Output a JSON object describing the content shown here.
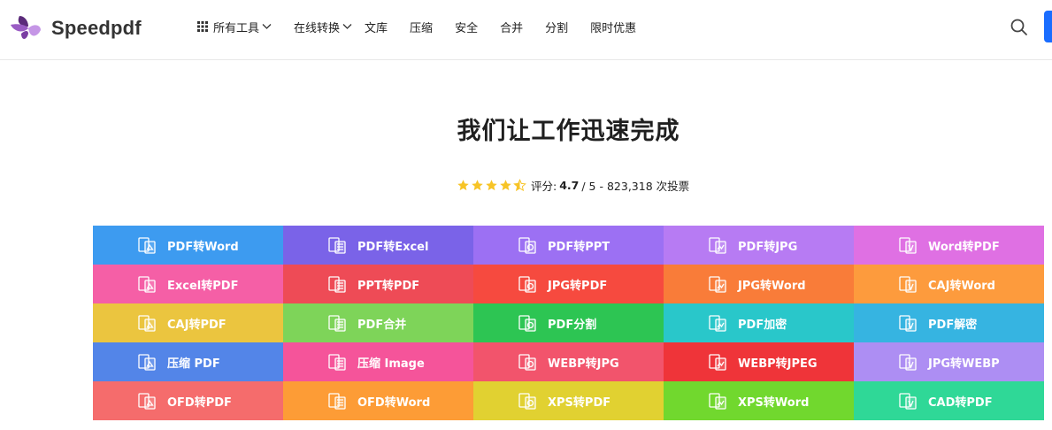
{
  "header": {
    "brand": "Speedpdf",
    "nav": [
      {
        "label": "所有工具",
        "icon": "grid-icon",
        "dropdown": true
      },
      {
        "label": "在线转换",
        "dropdown": true
      },
      {
        "label": "文库"
      },
      {
        "label": "压缩"
      },
      {
        "label": "安全"
      },
      {
        "label": "合并"
      },
      {
        "label": "分割"
      },
      {
        "label": "限时优惠"
      }
    ]
  },
  "hero": {
    "title": "我们让工作迅速完成",
    "rating": {
      "label": "评分:",
      "score": "4.7",
      "suffix": "/ 5 - 823,318 次投票",
      "stars_value": 4.5
    }
  },
  "tools": [
    {
      "label": "PDF转Word",
      "color": "#3d9bf0"
    },
    {
      "label": "PDF转Excel",
      "color": "#7a63e8"
    },
    {
      "label": "PDF转PPT",
      "color": "#9c70f3"
    },
    {
      "label": "PDF转JPG",
      "color": "#b77bf3"
    },
    {
      "label": "Word转PDF",
      "color": "#df70e3"
    },
    {
      "label": "Excel转PDF",
      "color": "#f55fa6"
    },
    {
      "label": "PPT转PDF",
      "color": "#ee4b56"
    },
    {
      "label": "JPG转PDF",
      "color": "#f64a3f"
    },
    {
      "label": "JPG转Word",
      "color": "#f97c39"
    },
    {
      "label": "CAJ转Word",
      "color": "#fd9b3d"
    },
    {
      "label": "CAJ转PDF",
      "color": "#ebc53f"
    },
    {
      "label": "PDF合并",
      "color": "#7ed459"
    },
    {
      "label": "PDF分割",
      "color": "#2dc553"
    },
    {
      "label": "PDF加密",
      "color": "#29c7ca"
    },
    {
      "label": "PDF解密",
      "color": "#36b4e1"
    },
    {
      "label": "压缩 PDF",
      "color": "#5385e8"
    },
    {
      "label": "压缩 Image",
      "color": "#f5549a"
    },
    {
      "label": "WEBP转JPG",
      "color": "#f2546c"
    },
    {
      "label": "WEBP转JPEG",
      "color": "#ef3439"
    },
    {
      "label": "JPG转WEBP",
      "color": "#ad8ef3"
    },
    {
      "label": "OFD转PDF",
      "color": "#f56c6c"
    },
    {
      "label": "OFD转Word",
      "color": "#fd9c36"
    },
    {
      "label": "XPS转PDF",
      "color": "#e1d131"
    },
    {
      "label": "XPS转Word",
      "color": "#71d82e"
    },
    {
      "label": "CAD转PDF",
      "color": "#2fd897"
    }
  ]
}
